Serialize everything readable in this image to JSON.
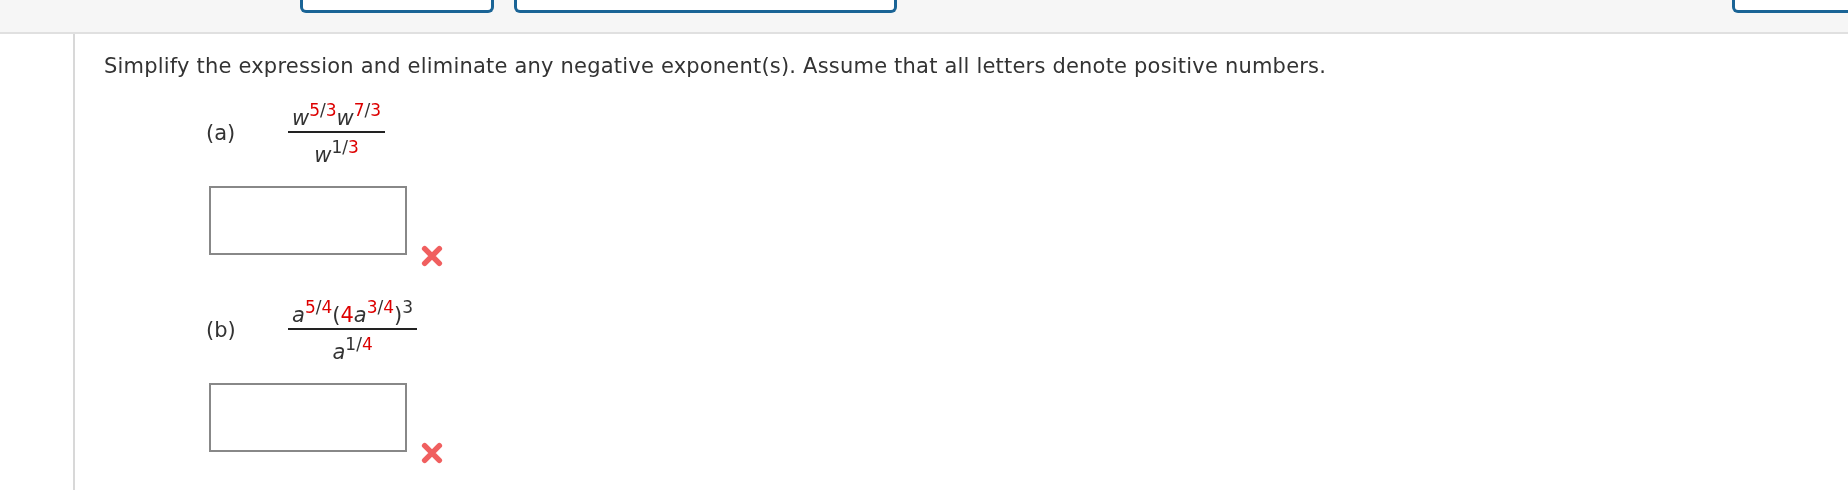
{
  "instruction": "Simplify the expression and eliminate any negative exponent(s). Assume that all letters denote positive numbers.",
  "parts": [
    {
      "label": "(a)",
      "answer": {
        "correct": false
      },
      "numerator": [
        {
          "text": "w",
          "kind": "var",
          "raised": false,
          "color": "#333333"
        },
        {
          "text": "5",
          "kind": "num",
          "raised": true,
          "color": "#dd0000"
        },
        {
          "text": "/",
          "kind": "num",
          "raised": true,
          "color": "#333333"
        },
        {
          "text": "3",
          "kind": "num",
          "raised": true,
          "color": "#dd0000"
        },
        {
          "text": "w",
          "kind": "var",
          "raised": false,
          "color": "#333333"
        },
        {
          "text": "7",
          "kind": "num",
          "raised": true,
          "color": "#dd0000"
        },
        {
          "text": "/",
          "kind": "num",
          "raised": true,
          "color": "#333333"
        },
        {
          "text": "3",
          "kind": "num",
          "raised": true,
          "color": "#dd0000"
        }
      ],
      "denominator": [
        {
          "text": "w",
          "kind": "var",
          "raised": false,
          "color": "#333333"
        },
        {
          "text": "1",
          "kind": "num",
          "raised": true,
          "color": "#333333"
        },
        {
          "text": "/",
          "kind": "num",
          "raised": true,
          "color": "#333333"
        },
        {
          "text": "3",
          "kind": "num",
          "raised": true,
          "color": "#dd0000"
        }
      ]
    },
    {
      "label": "(b)",
      "answer": {
        "correct": false
      },
      "numerator": [
        {
          "text": "a",
          "kind": "var",
          "raised": false,
          "color": "#333333"
        },
        {
          "text": "5",
          "kind": "num",
          "raised": true,
          "color": "#dd0000"
        },
        {
          "text": "/",
          "kind": "num",
          "raised": true,
          "color": "#333333"
        },
        {
          "text": "4",
          "kind": "num",
          "raised": true,
          "color": "#dd0000"
        },
        {
          "text": "(",
          "kind": "num",
          "raised": false,
          "color": "#333333"
        },
        {
          "text": "4",
          "kind": "num",
          "raised": false,
          "color": "#dd0000"
        },
        {
          "text": "a",
          "kind": "var",
          "raised": false,
          "color": "#333333"
        },
        {
          "text": "3",
          "kind": "num",
          "raised": true,
          "color": "#dd0000"
        },
        {
          "text": "/",
          "kind": "num",
          "raised": true,
          "color": "#333333"
        },
        {
          "text": "4",
          "kind": "num",
          "raised": true,
          "color": "#dd0000"
        },
        {
          "text": ")",
          "kind": "num",
          "raised": false,
          "color": "#333333"
        },
        {
          "text": "3",
          "kind": "num",
          "raised": true,
          "color": "#333333"
        }
      ],
      "denominator": [
        {
          "text": "a",
          "kind": "var",
          "raised": false,
          "color": "#333333"
        },
        {
          "text": "1",
          "kind": "num",
          "raised": true,
          "color": "#333333"
        },
        {
          "text": "/",
          "kind": "num",
          "raised": true,
          "color": "#333333"
        },
        {
          "text": "4",
          "kind": "num",
          "raised": true,
          "color": "#dd0000"
        }
      ]
    }
  ]
}
